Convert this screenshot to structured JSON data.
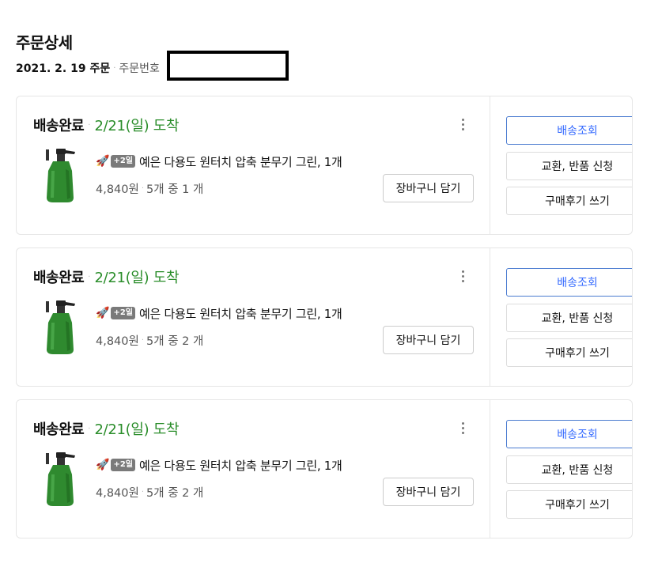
{
  "header": {
    "title": "주문상세",
    "order_date": "2021. 2. 19 주문",
    "order_no_label": "주문번호"
  },
  "orders": [
    {
      "status": "배송완료",
      "arrival": "2/21(일) 도착",
      "badge": "+2일",
      "product_name": "예은 다용도 원터치 압축 분무기 그린, 1개",
      "price": "4,840원",
      "quantity": "5개 중 1 개",
      "cart_label": "장바구니 담기",
      "track_label": "배송조회",
      "return_label": "교환, 반품 신청",
      "review_label": "구매후기 쓰기"
    },
    {
      "status": "배송완료",
      "arrival": "2/21(일) 도착",
      "badge": "+2일",
      "product_name": "예은 다용도 원터치 압축 분무기 그린, 1개",
      "price": "4,840원",
      "quantity": "5개 중 2 개",
      "cart_label": "장바구니 담기",
      "track_label": "배송조회",
      "return_label": "교환, 반품 신청",
      "review_label": "구매후기 쓰기"
    },
    {
      "status": "배송완료",
      "arrival": "2/21(일) 도착",
      "badge": "+2일",
      "product_name": "예은 다용도 원터치 압축 분무기 그린, 1개",
      "price": "4,840원",
      "quantity": "5개 중 2 개",
      "cart_label": "장바구니 담기",
      "track_label": "배송조회",
      "return_label": "교환, 반품 신청",
      "review_label": "구매후기 쓰기"
    }
  ],
  "icons": {
    "rocket": "rocket-icon",
    "more": "more-vertical-icon"
  },
  "colors": {
    "arrival_green": "#2a8d2a",
    "primary_blue": "#346aff",
    "badge_gray": "#7a7a7a"
  }
}
